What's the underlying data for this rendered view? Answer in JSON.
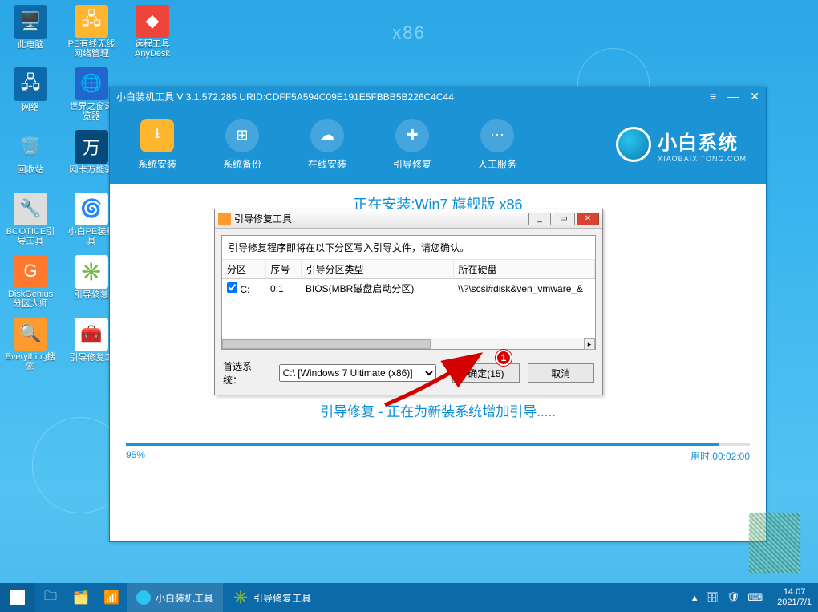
{
  "watermark": "x86",
  "desktop_icons": {
    "r0": [
      {
        "name": "pc",
        "label": "此电脑"
      },
      {
        "name": "pe-net",
        "label": "PE有线无线网络管理"
      },
      {
        "name": "anydesk",
        "label": "远程工具AnyDesk"
      }
    ],
    "r1": [
      {
        "name": "network",
        "label": "网络"
      },
      {
        "name": "world-browser",
        "label": "世界之窗浏览器"
      }
    ],
    "r2": [
      {
        "name": "recycle",
        "label": "回收站"
      },
      {
        "name": "netcard",
        "label": "网卡万能驱"
      }
    ],
    "r3": [
      {
        "name": "bootice",
        "label": "BOOTICE引导工具"
      },
      {
        "name": "xiaobai-pe",
        "label": "小白PE装机具"
      }
    ],
    "r4": [
      {
        "name": "diskgenius",
        "label": "DiskGenius分区大师"
      },
      {
        "name": "boot-repair",
        "label": "引导修复"
      }
    ],
    "r5": [
      {
        "name": "everything",
        "label": "Everything搜索"
      },
      {
        "name": "boot-repair-tool",
        "label": "引导修复工"
      }
    ]
  },
  "app": {
    "title": "小白装机工具 V 3.1.572.285 URID:CDFF5A594C09E191E5FBBB5B226C4C44",
    "toolbar": [
      {
        "name": "sys-install",
        "label": "系统安装"
      },
      {
        "name": "sys-backup",
        "label": "系统备份"
      },
      {
        "name": "online-install",
        "label": "在线安装"
      },
      {
        "name": "boot-repair",
        "label": "引导修复"
      },
      {
        "name": "manual-service",
        "label": "人工服务"
      }
    ],
    "brand": {
      "big": "小白系统",
      "small": "XIAOBAIXITONG.COM"
    },
    "installing": "正在安装:Win7 旗舰版 x86",
    "status": "引导修复 - 正在为新装系统增加引导.....",
    "progress": {
      "pct": 95,
      "pct_label": "95%",
      "elapsed_label": "用时:00:02:00"
    }
  },
  "dialog": {
    "title": "引导修复工具",
    "msg": "引导修复程序即将在以下分区写入引导文件，请您确认。",
    "cols": {
      "c0": "分区",
      "c1": "序号",
      "c2": "引导分区类型",
      "c3": "所在硬盘"
    },
    "row": {
      "part": "C:",
      "idx": "0:1",
      "type": "BIOS(MBR磁盘启动分区)",
      "disk": "\\\\?\\scsi#disk&ven_vmware_&"
    },
    "pref_label": "首选系统：",
    "pref_system": "C:\\ [Windows 7 Ultimate (x86)]",
    "ok": "确定(15)",
    "cancel": "取消"
  },
  "annotation": "1",
  "taskbar": {
    "item1": "小白装机工具",
    "item2": "引导修复工具",
    "clock": {
      "time": "14:07",
      "date": "2021/7/1"
    }
  }
}
